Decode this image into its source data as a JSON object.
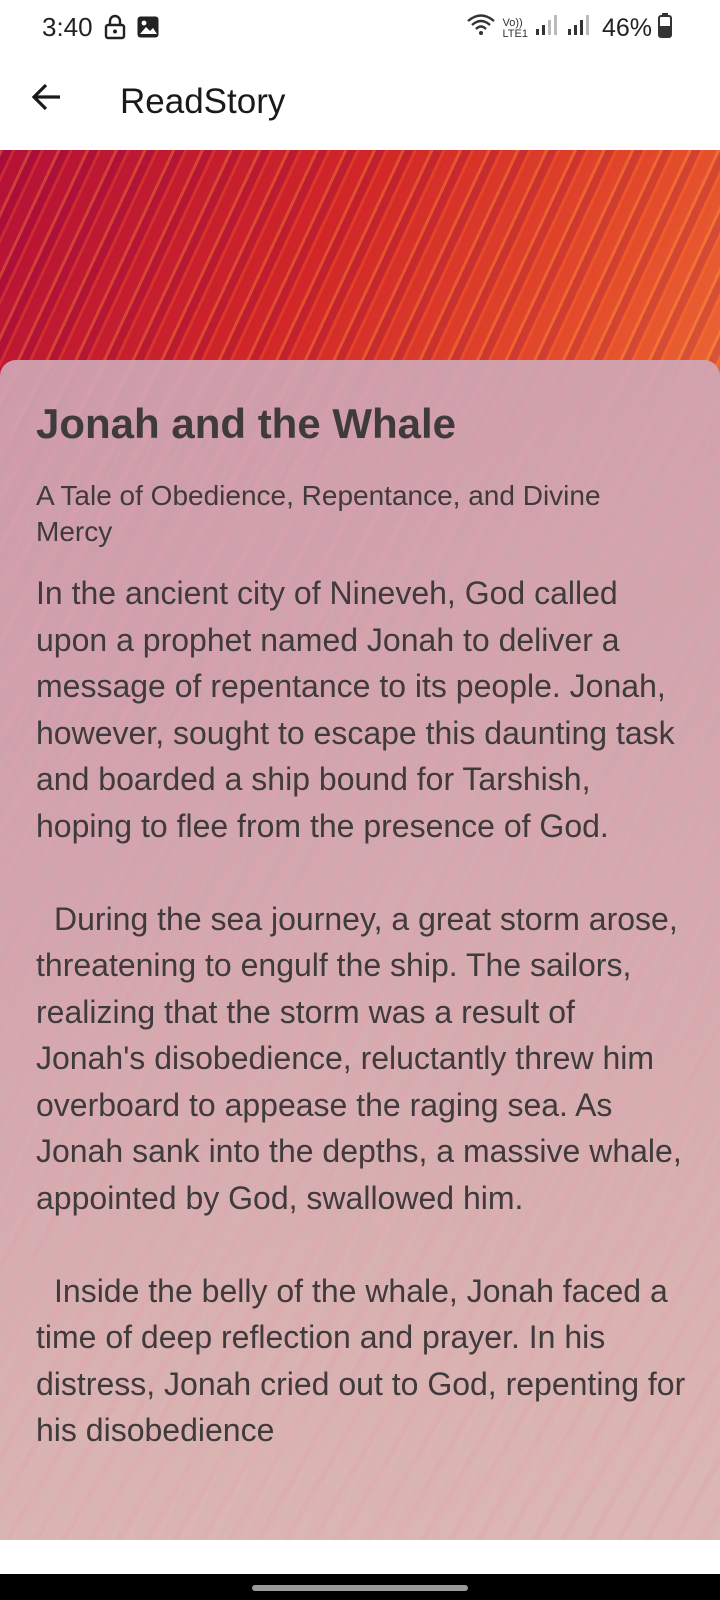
{
  "status_bar": {
    "time": "3:40",
    "left_icons": [
      "lock-icon",
      "image-icon"
    ],
    "right_icons": [
      "wifi-icon",
      "volte-icon",
      "signal-icon",
      "signal-icon",
      "battery-icon"
    ],
    "network_label_top": "Vo))",
    "network_label_bottom": "LTE1",
    "battery": "46%"
  },
  "app_bar": {
    "back_icon": "arrow-left-icon",
    "title": "ReadStory"
  },
  "story": {
    "title": "Jonah and the Whale",
    "subtitle": "A Tale of Obedience, Repentance, and Divine Mercy",
    "paragraphs": [
      "In the ancient city of Nineveh, God called upon a prophet named Jonah to deliver a message of repentance to its people. Jonah, however, sought to escape this daunting task and boarded a ship bound for Tarshish, hoping to flee from the presence of God.",
      "During the sea journey, a great storm arose, threatening to engulf the ship. The sailors, realizing that the storm was a result of Jonah's disobedience, reluctantly threw him overboard to appease the raging sea. As Jonah sank into the depths, a massive whale, appointed by God, swallowed him.",
      "Inside the belly of the whale, Jonah faced a time of deep reflection and prayer. In his distress, Jonah cried out to God, repenting for his disobedience"
    ]
  },
  "colors": {
    "title_text": "#3f3a3c",
    "hero_red": "#d22a28",
    "hero_orange": "#f07035",
    "card_pink": "#cfa3b0"
  }
}
